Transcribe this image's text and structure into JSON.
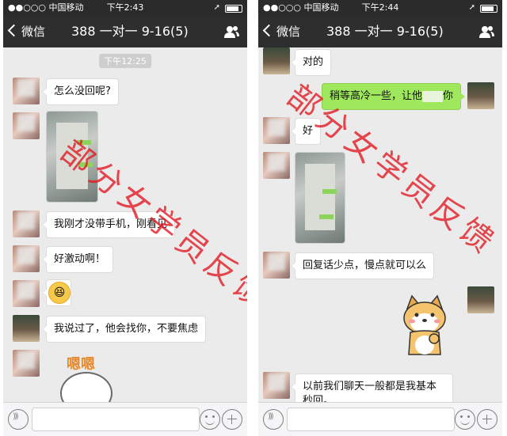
{
  "left": {
    "status": {
      "carrier": "●●○○○ 中国移动",
      "time": "下午2:43"
    },
    "nav": {
      "back_label": "微信",
      "title": "388 一对一 9-16(5)"
    },
    "timestamp": "下午12:25",
    "messages": [
      {
        "sender": "her",
        "type": "text",
        "text": "怎么没回呢?"
      },
      {
        "sender": "her",
        "type": "image"
      },
      {
        "sender": "her",
        "type": "text",
        "text": "我刚才没带手机，刚看见"
      },
      {
        "sender": "her",
        "type": "text",
        "text": "好激动啊！"
      },
      {
        "sender": "her",
        "type": "emoji",
        "icon": "laughing-emoji"
      },
      {
        "sender": "me",
        "type": "text",
        "text": "我说过了，他会找你，不要焦虑"
      },
      {
        "sender": "her",
        "type": "sticker",
        "text": "嗯嗯"
      }
    ],
    "watermark": "部分女学员反馈"
  },
  "right": {
    "status": {
      "carrier": "●●○○○ 中国移动",
      "time": "下午2:44"
    },
    "nav": {
      "back_label": "微信",
      "title": "388 一对一 9-16(5)"
    },
    "messages": [
      {
        "sender": "me",
        "type": "text",
        "text": "对的"
      },
      {
        "sender": "me",
        "type": "text",
        "text": "稍等高冷一些，让他",
        "suffix": "你"
      },
      {
        "sender": "her",
        "type": "text",
        "text": "好"
      },
      {
        "sender": "her",
        "type": "image"
      },
      {
        "sender": "her",
        "type": "text",
        "text": "回复话少点，慢点就可以么"
      },
      {
        "sender": "me",
        "type": "sticker",
        "icon": "shiba-dog-sticker"
      },
      {
        "sender": "her",
        "type": "text",
        "text": "以前我们聊天一般都是我基本秒回。"
      }
    ],
    "watermark": "部分女学员反馈"
  },
  "colors": {
    "nav_bg": "#2e2e2e",
    "chat_bg": "#ebebeb",
    "my_bubble": "#9fe85d",
    "watermark": "#e1141e"
  }
}
